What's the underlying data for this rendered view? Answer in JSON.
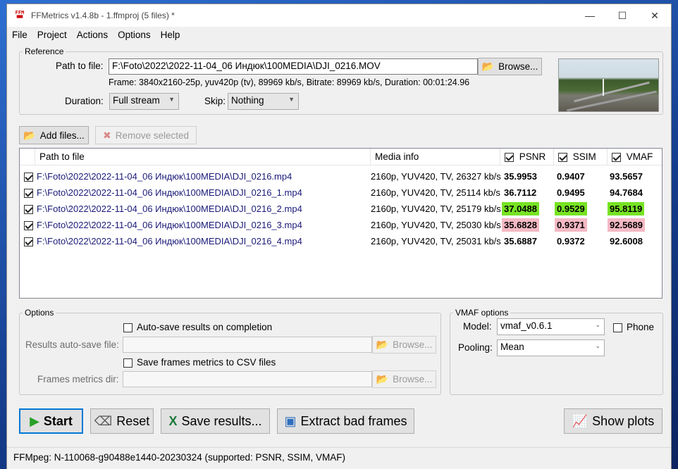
{
  "window": {
    "title": "FFMetrics v1.4.8b - 1.ffmproj (5 files) *",
    "minimize": "—",
    "maximize": "☐",
    "close": "✕"
  },
  "menu": [
    "File",
    "Project",
    "Actions",
    "Options",
    "Help"
  ],
  "reference": {
    "legend": "Reference",
    "path_label": "Path to file:",
    "path_value": "F:\\Foto\\2022\\2022-11-04_06 Индюк\\100MEDIA\\DJI_0216.MOV",
    "browse": "Browse...",
    "frame_info": "Frame: 3840x2160-25p, yuv420p (tv), 89969 kb/s, Bitrate: 89969 kb/s, Duration: 00:01:24.96",
    "duration_label": "Duration:",
    "duration_value": "Full stream",
    "skip_label": "Skip:",
    "skip_value": "Nothing"
  },
  "files_toolbar": {
    "add": "Add files...",
    "remove": "Remove selected"
  },
  "table": {
    "headers": {
      "path": "Path to file",
      "media": "Media info",
      "psnr": "PSNR",
      "ssim": "SSIM",
      "vmaf": "VMAF"
    },
    "rows": [
      {
        "path": "F:\\Foto\\2022\\2022-11-04_06 Индюк\\100MEDIA\\DJI_0216.mp4",
        "media": "2160p, YUV420, TV, 26327 kb/s",
        "psnr": "35.9953",
        "ssim": "0.9407",
        "vmaf": "93.5657"
      },
      {
        "path": "F:\\Foto\\2022\\2022-11-04_06 Индюк\\100MEDIA\\DJI_0216_1.mp4",
        "media": "2160p, YUV420, TV, 25114 kb/s",
        "psnr": "36.7112",
        "ssim": "0.9495",
        "vmaf": "94.7684"
      },
      {
        "path": "F:\\Foto\\2022\\2022-11-04_06 Индюк\\100MEDIA\\DJI_0216_2.mp4",
        "media": "2160p, YUV420, TV, 25179 kb/s",
        "psnr": "37.0488",
        "ssim": "0.9529",
        "vmaf": "95.8119"
      },
      {
        "path": "F:\\Foto\\2022\\2022-11-04_06 Индюк\\100MEDIA\\DJI_0216_3.mp4",
        "media": "2160p, YUV420, TV, 25030 kb/s",
        "psnr": "35.6828",
        "ssim": "0.9371",
        "vmaf": "92.5689"
      },
      {
        "path": "F:\\Foto\\2022\\2022-11-04_06 Индюк\\100MEDIA\\DJI_0216_4.mp4",
        "media": "2160p, YUV420, TV, 25031 kb/s",
        "psnr": "35.6887",
        "ssim": "0.9372",
        "vmaf": "92.6008"
      }
    ],
    "highlight_best_color": "#77e324",
    "highlight_worst_color": "#f4b9c4"
  },
  "options": {
    "legend": "Options",
    "autosave_checkbox": "Auto-save results on completion",
    "autosave_label": "Results auto-save file:",
    "autosave_value": "",
    "browse1": "Browse...",
    "csv_checkbox": "Save frames metrics to CSV files",
    "frames_dir_label": "Frames metrics dir:",
    "frames_dir_value": "",
    "browse2": "Browse..."
  },
  "vmaf_options": {
    "legend": "VMAF options",
    "model_label": "Model:",
    "model_value": "vmaf_v0.6.1",
    "phone_label": "Phone",
    "pooling_label": "Pooling:",
    "pooling_value": "Mean"
  },
  "actions": {
    "start": "Start",
    "reset": "Reset",
    "save": "Save results...",
    "extract": "Extract bad frames",
    "plots": "Show plots"
  },
  "status": "FFMpeg: N-110068-g90488e1440-20230324 (supported: PSNR, SSIM, VMAF)",
  "icons": {
    "app": "ffm-logo-icon",
    "browse": "folder-open-icon",
    "add": "add-files-icon",
    "remove": "remove-icon",
    "start": "play-icon",
    "reset": "eraser-icon",
    "save": "excel-icon",
    "extract": "image-export-icon",
    "plots": "chart-icon"
  }
}
